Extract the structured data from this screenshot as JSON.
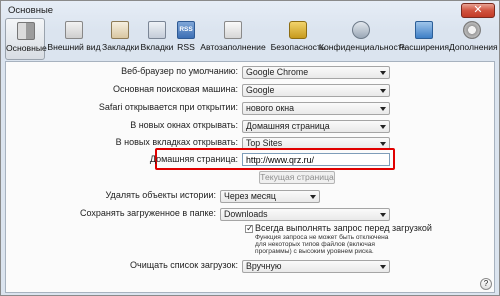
{
  "window": {
    "title": "Основные",
    "close_label": "✕"
  },
  "toolbar": [
    {
      "label": "Основные",
      "icon": "general-switch-icon"
    },
    {
      "label": "Внешний вид",
      "icon": "appearance-icon"
    },
    {
      "label": "Закладки",
      "icon": "bookmarks-icon"
    },
    {
      "label": "Вкладки",
      "icon": "tabs-icon"
    },
    {
      "label": "RSS",
      "icon": "rss-icon",
      "icon_text": "RSS"
    },
    {
      "label": "Автозаполнение",
      "icon": "autofill-icon"
    },
    {
      "label": "Безопасность",
      "icon": "lock-icon"
    },
    {
      "label": "Конфиденциальность",
      "icon": "privacy-icon"
    },
    {
      "label": "Расширения",
      "icon": "extensions-icon"
    },
    {
      "label": "Дополнения",
      "icon": "gear-icon"
    }
  ],
  "settings": {
    "default_browser": {
      "label": "Веб-браузер по умолчанию:",
      "value": "Google Chrome"
    },
    "search_engine": {
      "label": "Основная поисковая машина:",
      "value": "Google"
    },
    "safari_opens": {
      "label": "Safari открывается при открытии:",
      "value": "нового окна"
    },
    "new_windows": {
      "label": "В новых окнах открывать:",
      "value": "Домашняя страница"
    },
    "new_tabs": {
      "label": "В новых вкладках открывать:",
      "value": "Top Sites"
    },
    "homepage": {
      "label": "Домашняя страница:",
      "value": "http://www.qrz.ru/"
    },
    "current_page_button": "Текущая страница",
    "remove_history": {
      "label": "Удалять объекты истории:",
      "value": "Через месяц"
    },
    "save_downloads": {
      "label": "Сохранять загруженное в папке:",
      "value": "Downloads"
    },
    "ask_before_download": {
      "label": "Всегда выполнять запрос перед загрузкой",
      "checked_mark": "✓",
      "note": "Функция запроса не может быть отключена для некоторых типов файлов (включая программы) с высоким уровнем риска."
    },
    "clear_downloads": {
      "label": "Очищать список загрузок:",
      "value": "Вручную"
    }
  },
  "help_label": "?",
  "colors": {
    "highlight": "#e00000",
    "active_tab": "#d8dde3"
  }
}
